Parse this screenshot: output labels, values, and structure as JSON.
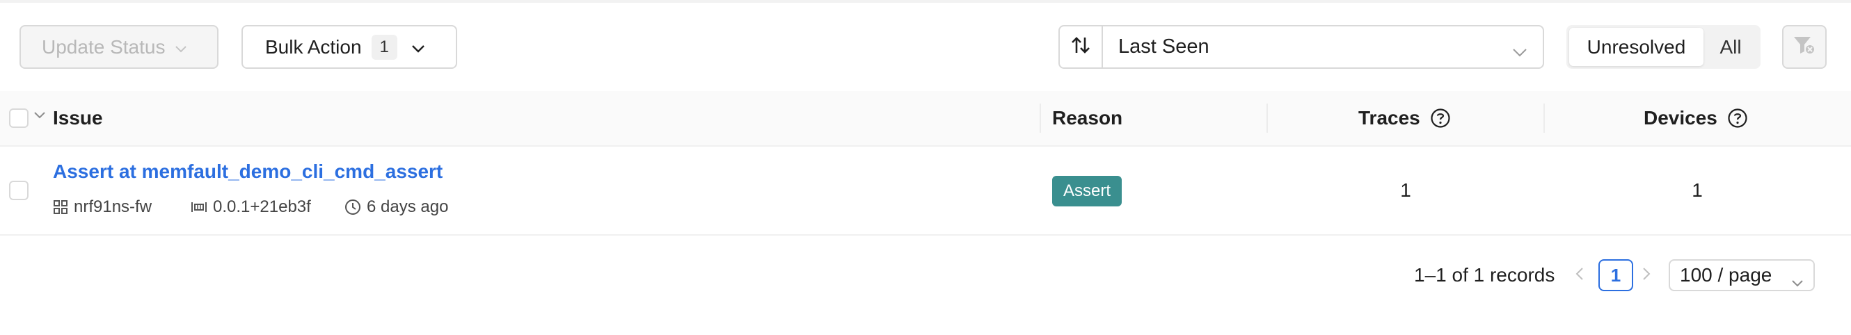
{
  "toolbar": {
    "update_status_label": "Update Status",
    "bulk_action_label": "Bulk Action",
    "bulk_action_count": "1",
    "sort_label": "Last Seen",
    "segment": {
      "options": [
        "Unresolved",
        "All"
      ],
      "selected": "Unresolved"
    }
  },
  "table": {
    "columns": [
      "Issue",
      "Reason",
      "Traces",
      "Devices"
    ],
    "rows": [
      {
        "title": "Assert at memfault_demo_cli_cmd_assert",
        "software_type": "nrf91ns-fw",
        "version": "0.0.1+21eb3f",
        "last_seen": "6 days ago",
        "reason": "Assert",
        "traces": "1",
        "devices": "1"
      }
    ]
  },
  "pagination": {
    "summary": "1–1 of 1 records",
    "current_page": "1",
    "page_size": "100 / page"
  },
  "colors": {
    "link": "#2c6fe0",
    "reason_tag": "#3a8f8f",
    "border": "#d9d9d9"
  },
  "icons": [
    "chevron-down-icon",
    "sort-arrows-icon",
    "filter-clear-icon",
    "help-circle-icon",
    "grid-icon",
    "version-icon",
    "clock-icon",
    "chevron-left-icon",
    "chevron-right-icon"
  ]
}
